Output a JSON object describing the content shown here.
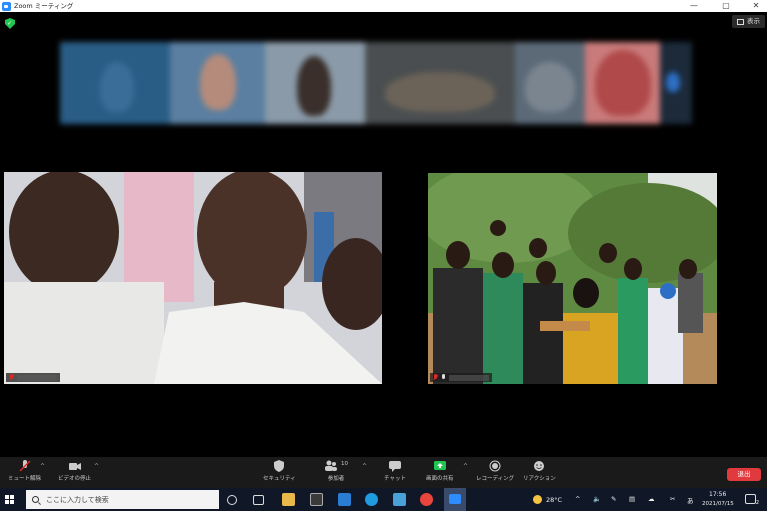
{
  "window": {
    "title": "Zoom ミーティング",
    "minimize": "—",
    "maximize": "▢",
    "close": "✕"
  },
  "meeting": {
    "view_button": "表示"
  },
  "toolbar": {
    "mute_label": "ミュート解除",
    "video_label": "ビデオの停止",
    "security_label": "セキュリティ",
    "participants_label": "参加者",
    "participants_count": "10",
    "chat_label": "チャット",
    "share_label": "画面の共有",
    "record_label": "レコーディング",
    "reaction_label": "リアクション",
    "end_label": "退出",
    "caret": "^"
  },
  "taskbar": {
    "search_placeholder": "ここに入力して検索",
    "weather": "28°C",
    "ime": "あ",
    "time": "17:56",
    "date": "2021/07/15",
    "notifications": "2"
  },
  "colors": {
    "zoom_blue": "#2d8cff",
    "end_red": "#e0393e",
    "shield_green": "#23c552",
    "share_green": "#23c552"
  }
}
